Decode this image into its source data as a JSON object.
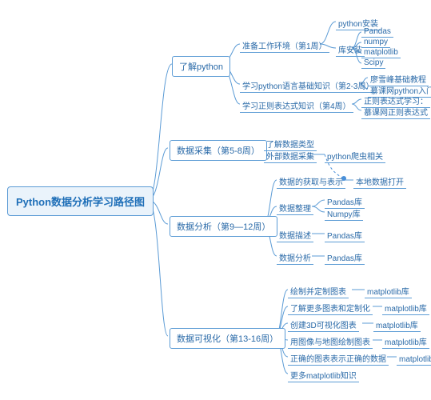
{
  "root": "Python数据分析学习路径图",
  "branches": [
    {
      "label": "了解python",
      "children": [
        {
          "label": "准备工作环境（第1周）",
          "children": [
            {
              "label": "python安装"
            },
            {
              "label": "库安装",
              "children": [
                "Pandas",
                "numpy",
                "matplotlib",
                "Scipy"
              ]
            }
          ]
        },
        {
          "label": "学习python语言基础知识（第2-3周）",
          "children": [
            "廖雪峰基础教程",
            "慕课网python入门"
          ]
        },
        {
          "label": "学习正则表达式知识（第4周）",
          "children": [
            "正则表达式学习：",
            "慕课网正则表达式"
          ]
        }
      ]
    },
    {
      "label": "数据采集（第5-8周）",
      "children": [
        {
          "label": "了解数据类型"
        },
        {
          "label": "外部数据采集",
          "children": [
            "python爬虫相关"
          ]
        }
      ]
    },
    {
      "label": "数据分析（第9—12周）",
      "children": [
        {
          "label": "数据的获取与表示",
          "children": [
            "本地数据打开"
          ]
        },
        {
          "label": "数据整理",
          "children": [
            "Pandas库",
            "Numpy库"
          ]
        },
        {
          "label": "数据描述",
          "children": [
            "Pandas库"
          ]
        },
        {
          "label": "数据分析",
          "children": [
            "Pandas库"
          ]
        }
      ]
    },
    {
      "label": "数据可视化（第13-16周）",
      "children": [
        {
          "label": "绘制并定制图表",
          "children": [
            "matplotlib库"
          ]
        },
        {
          "label": "了解更多图表和定制化",
          "children": [
            "matplotlib库"
          ]
        },
        {
          "label": "创建3D可视化图表",
          "children": [
            "matplotlib库"
          ]
        },
        {
          "label": "用图像与地图绘制图表",
          "children": [
            "matplotlib库"
          ]
        },
        {
          "label": "正确的图表表示正确的数据",
          "children": [
            "matplotlib库"
          ]
        },
        {
          "label": "更多matplotlib知识"
        }
      ]
    }
  ]
}
